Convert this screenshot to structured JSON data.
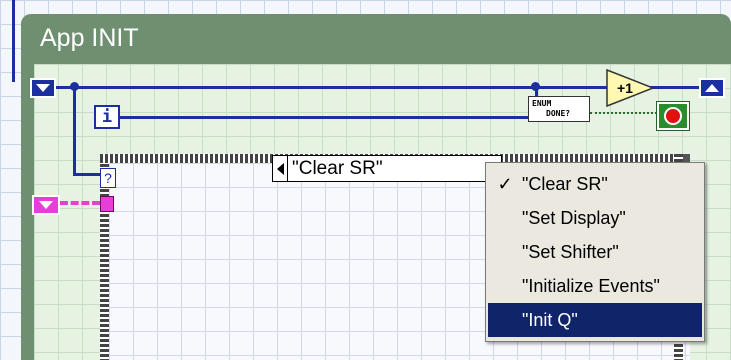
{
  "window": {
    "structure_title": "App INIT"
  },
  "terminals": {
    "iteration_label": "i",
    "increment_label": "+1",
    "enum_constant_line1": "ENUM",
    "enum_constant_line2": "DONE?",
    "case_selector_label": "?"
  },
  "case_structure": {
    "selected_case": "\"Clear SR\""
  },
  "menu": {
    "items": [
      {
        "label": "\"Clear SR\"",
        "checked": true,
        "highlighted": false
      },
      {
        "label": "\"Set Display\"",
        "checked": false,
        "highlighted": false
      },
      {
        "label": "\"Set Shifter\"",
        "checked": false,
        "highlighted": false
      },
      {
        "label": "\"Initialize Events\"",
        "checked": false,
        "highlighted": false
      },
      {
        "label": "\"Init Q\"",
        "checked": false,
        "highlighted": true
      }
    ],
    "check_glyph": "✓"
  },
  "colors": {
    "frame_green": "#6f9070",
    "wire_blue": "#1c2fa0",
    "cluster_pink": "#e83ed8",
    "menu_highlight": "#10246a",
    "stop_red": "#e01010"
  }
}
